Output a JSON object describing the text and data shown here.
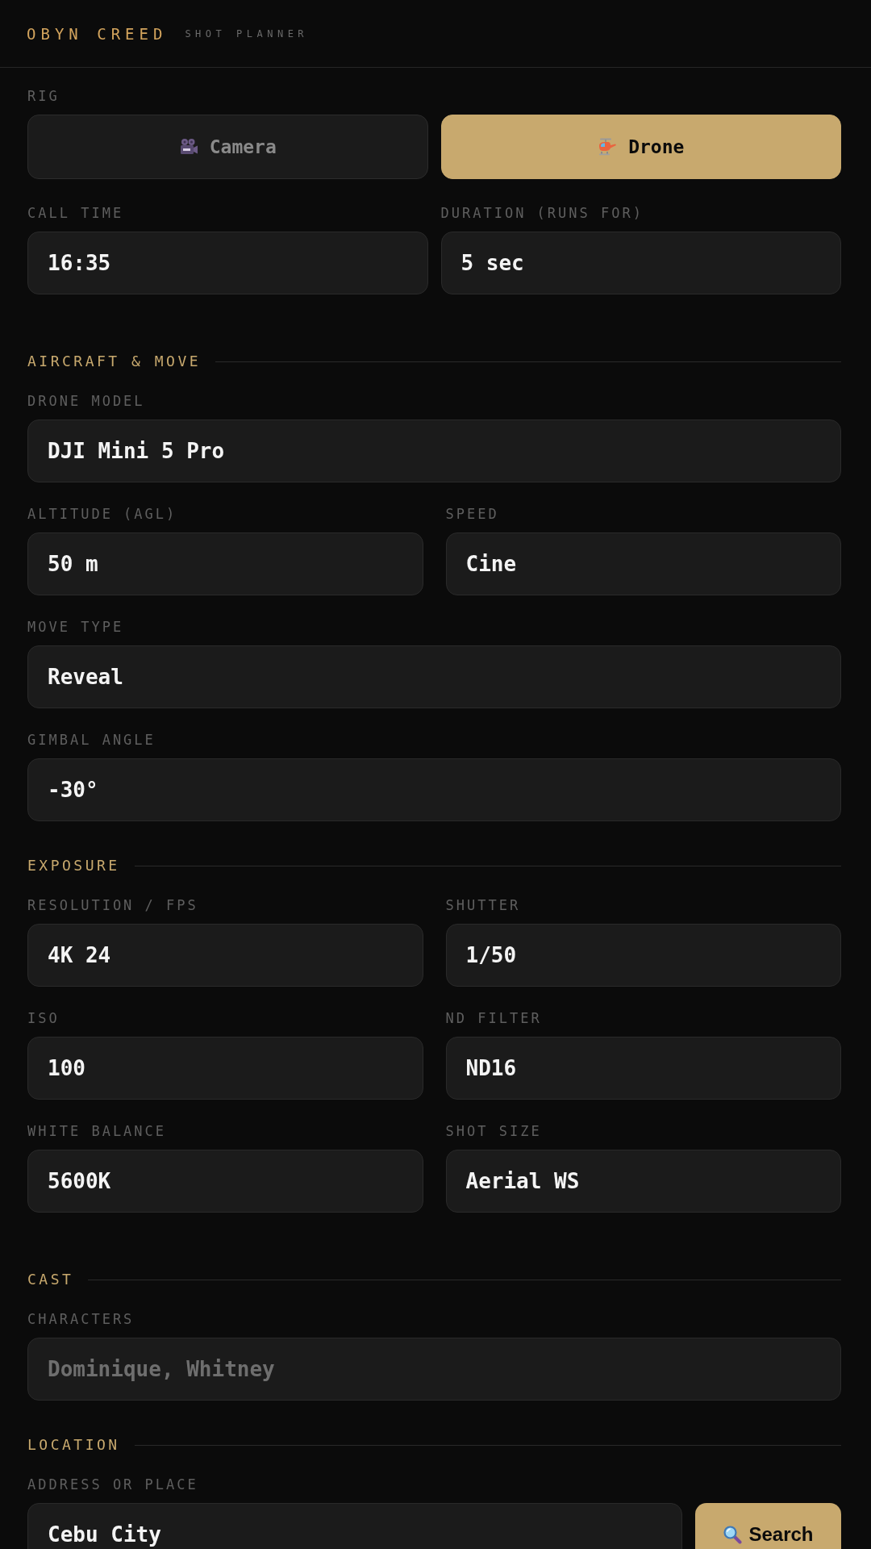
{
  "header": {
    "title": "OBYN CREED",
    "subtitle": "SHOT PLANNER"
  },
  "rig": {
    "label": "RIG",
    "options": [
      {
        "kind": "camera",
        "label": "Camera",
        "selected": false
      },
      {
        "kind": "drone",
        "label": "Drone",
        "selected": true
      }
    ]
  },
  "sections": [
    {
      "rows": [
        [
          {
            "label": "CALL TIME",
            "value": "16:35"
          },
          {
            "label": "DURATION (RUNS FOR)",
            "value": "5 sec"
          }
        ]
      ]
    },
    {
      "title": "AIRCRAFT & MOVE",
      "rows": [
        [
          {
            "label": "DRONE MODEL",
            "value": "DJI Mini 5 Pro"
          }
        ],
        [
          {
            "label": "ALTITUDE (AGL)",
            "value": "50 m"
          },
          {
            "label": "SPEED",
            "value": "Cine"
          }
        ],
        [
          {
            "label": "MOVE TYPE",
            "value": "Reveal"
          }
        ],
        [
          {
            "label": "GIMBAL ANGLE",
            "value": "-30°"
          }
        ]
      ]
    },
    {
      "title": "EXPOSURE",
      "rows": [
        [
          {
            "label": "RESOLUTION / FPS",
            "value": "4K 24"
          },
          {
            "label": "SHUTTER",
            "value": "1/50"
          }
        ],
        [
          {
            "label": "ISO",
            "value": "100"
          },
          {
            "label": "ND FILTER",
            "value": "ND16"
          }
        ],
        [
          {
            "label": "WHITE BALANCE",
            "value": "5600K"
          },
          {
            "label": "SHOT SIZE",
            "value": "Aerial WS"
          }
        ]
      ]
    },
    {
      "title": "CAST",
      "rows": [
        [
          {
            "label": "CHARACTERS",
            "placeholder": "Dominique, Whitney"
          }
        ]
      ]
    },
    {
      "title": "LOCATION",
      "rows": [
        [
          {
            "label": "ADDRESS OR PLACE",
            "value": "Cebu City",
            "action": {
              "label": "Search"
            }
          }
        ]
      ]
    }
  ]
}
